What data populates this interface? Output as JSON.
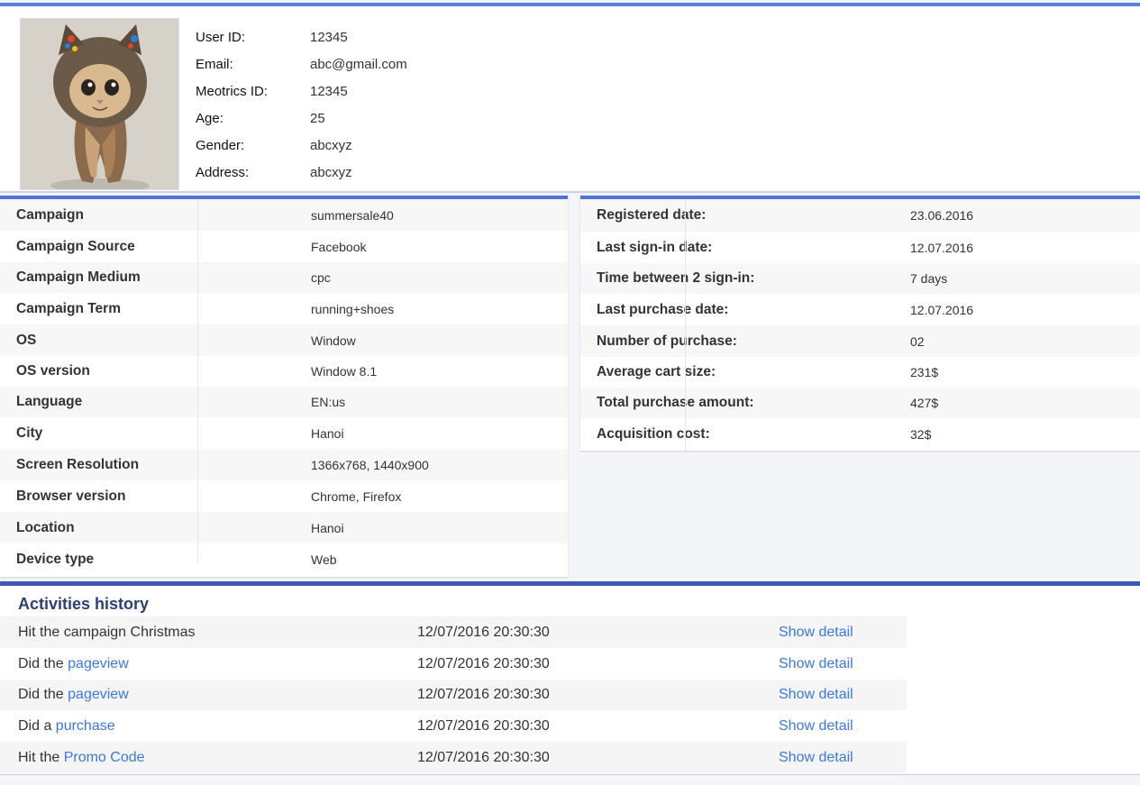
{
  "profile": {
    "fields": [
      {
        "label": "User ID:",
        "value": "12345"
      },
      {
        "label": "Email:",
        "value": "abc@gmail.com"
      },
      {
        "label": "Meotrics ID:",
        "value": "12345"
      },
      {
        "label": "Age:",
        "value": "25"
      },
      {
        "label": "Gender:",
        "value": "abcxyz"
      },
      {
        "label": "Address:",
        "value": "abcxyz"
      }
    ]
  },
  "campaign_info": [
    {
      "label": "Campaign",
      "value": "summersale40"
    },
    {
      "label": "Campaign Source",
      "value": "Facebook"
    },
    {
      "label": "Campaign Medium",
      "value": "cpc"
    },
    {
      "label": "Campaign Term",
      "value": "running+shoes"
    },
    {
      "label": "OS",
      "value": "Window"
    },
    {
      "label": "OS version",
      "value": "Window 8.1"
    },
    {
      "label": "Language",
      "value": "EN:us"
    },
    {
      "label": "City",
      "value": "Hanoi"
    },
    {
      "label": "Screen Resolution",
      "value": "1366x768, 1440x900"
    },
    {
      "label": "Browser version",
      "value": "Chrome, Firefox"
    },
    {
      "label": "Location",
      "value": "Hanoi"
    },
    {
      "label": "Device type",
      "value": "Web"
    }
  ],
  "purchase_info": [
    {
      "label": "Registered date:",
      "value": "23.06.2016"
    },
    {
      "label": "Last sign-in date:",
      "value": "12.07.2016"
    },
    {
      "label": "Time between 2 sign-in:",
      "value": "7 days"
    },
    {
      "label": "Last purchase date:",
      "value": "12.07.2016"
    },
    {
      "label": "Number of purchase:",
      "value": "02"
    },
    {
      "label": "Average cart size:",
      "value": "231$"
    },
    {
      "label": "Total purchase amount:",
      "value": "427$"
    },
    {
      "label": "Acquisition cost:",
      "value": "32$"
    }
  ],
  "activities": {
    "title": "Activities history",
    "items": [
      {
        "prefix": "Hit the campaign Christmas",
        "link": "",
        "time": "12/07/2016 20:30:30",
        "detail": "Show detail"
      },
      {
        "prefix": "Did the ",
        "link": "pageview",
        "time": "12/07/2016 20:30:30",
        "detail": "Show detail"
      },
      {
        "prefix": "Did the ",
        "link": "pageview",
        "time": "12/07/2016 20:30:30",
        "detail": "Show detail"
      },
      {
        "prefix": "Did a ",
        "link": "purchase",
        "time": "12/07/2016 20:30:30",
        "detail": "Show detail"
      },
      {
        "prefix": "Hit the ",
        "link": "Promo Code",
        "time": "12/07/2016 20:30:30",
        "detail": "Show detail"
      }
    ]
  },
  "colors": {
    "accent": "#4f73d8",
    "link": "#3b78e7",
    "heading": "#2b3f7a"
  }
}
